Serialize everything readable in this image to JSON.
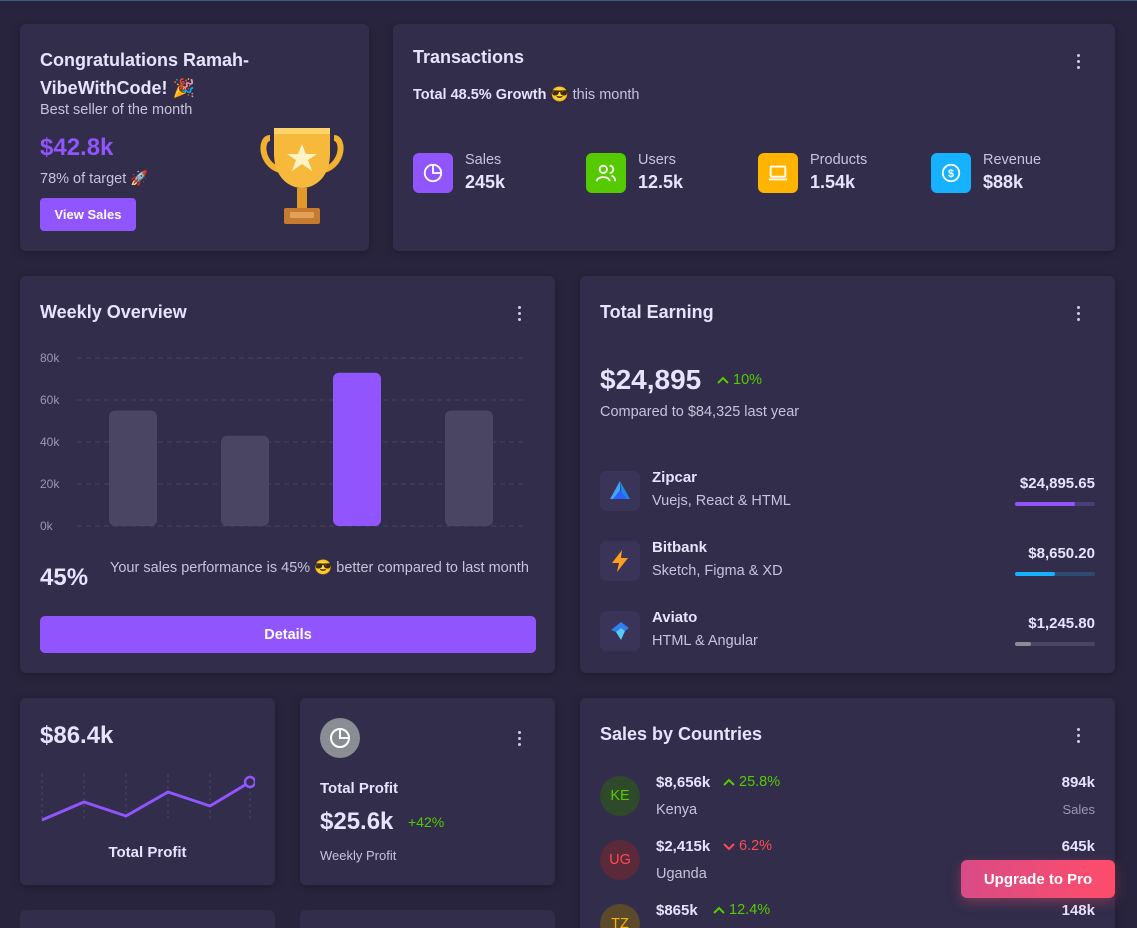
{
  "congrats": {
    "title": "Congratulations Ramah-VibeWithCode! 🎉",
    "subtitle": "Best seller of the month",
    "amount": "$42.8k",
    "target": "78% of target 🚀",
    "button": "View Sales"
  },
  "transactions": {
    "title": "Transactions",
    "growth_prefix": "Total 48.5% Growth",
    "growth_suffix": "😎 this month",
    "stats": [
      {
        "label": "Sales",
        "value": "245k",
        "icon": "pie-chart-icon",
        "color": "#9155fd"
      },
      {
        "label": "Users",
        "value": "12.5k",
        "icon": "users-icon",
        "color": "#56ca00"
      },
      {
        "label": "Products",
        "value": "1.54k",
        "icon": "laptop-icon",
        "color": "#ffb400"
      },
      {
        "label": "Revenue",
        "value": "$88k",
        "icon": "dollar-icon",
        "color": "#16b1ff"
      }
    ]
  },
  "weekly": {
    "title": "Weekly Overview",
    "percent": "45%",
    "description": "Your sales performance is 45% 😎 better compared to last month",
    "button": "Details"
  },
  "chart_data": {
    "type": "bar",
    "title": "Weekly Overview",
    "categories": [
      "",
      "",
      "",
      ""
    ],
    "values": [
      55,
      43,
      73,
      55
    ],
    "yticks": [
      "80k",
      "60k",
      "40k",
      "20k",
      "0k"
    ],
    "ylim": [
      0,
      80
    ],
    "highlight_index": 2,
    "colors": {
      "bar": "#4a4563",
      "highlight": "#9155fd"
    },
    "grid": true
  },
  "earning": {
    "title": "Total Earning",
    "amount": "$24,895",
    "change": "10%",
    "compare": "Compared to $84,325 last year",
    "items": [
      {
        "name": "Zipcar",
        "tech": "Vuejs, React & HTML",
        "amount": "$24,895.65",
        "progress": 0.75,
        "color": "#9155fd",
        "icon": "zipcar-logo-icon"
      },
      {
        "name": "Bitbank",
        "tech": "Sketch, Figma & XD",
        "amount": "$8,650.20",
        "progress": 0.5,
        "color": "#16b1ff",
        "icon": "lightning-logo-icon"
      },
      {
        "name": "Aviato",
        "tech": "HTML & Angular",
        "amount": "$1,245.80",
        "progress": 0.2,
        "color": "#8a8d93",
        "icon": "aviato-logo-icon"
      }
    ]
  },
  "profit_line": {
    "amount": "$86.4k",
    "label": "Total Profit"
  },
  "total_profit": {
    "label": "Total Profit",
    "amount": "$25.6k",
    "change": "+42%",
    "sublabel": "Weekly Profit"
  },
  "countries": {
    "title": "Sales by Countries",
    "rows": [
      {
        "code": "KE",
        "amount": "$8,656k",
        "change": "25.8%",
        "trend": "up",
        "name": "Kenya",
        "sales": "894k",
        "sales_label": "Sales"
      },
      {
        "code": "UG",
        "amount": "$2,415k",
        "change": "6.2%",
        "trend": "down",
        "name": "Uganda",
        "sales": "645k",
        "sales_label": ""
      },
      {
        "code": "TZ",
        "amount": "$865k",
        "change": "12.4%",
        "trend": "up",
        "name": "",
        "sales": "148k",
        "sales_label": ""
      }
    ]
  },
  "upgrade": "Upgrade to Pro"
}
